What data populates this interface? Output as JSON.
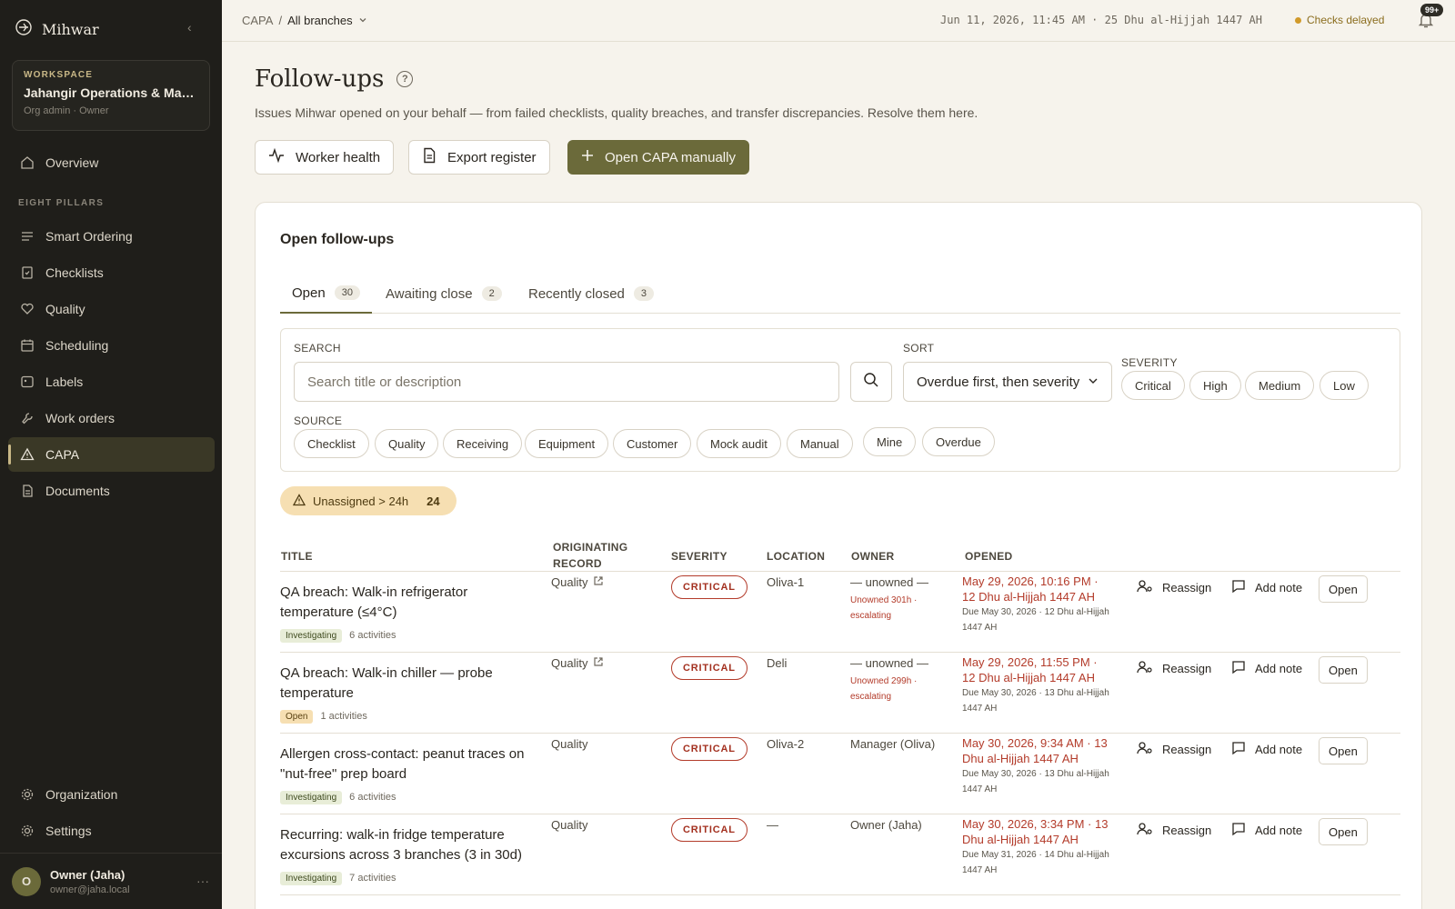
{
  "sidebar": {
    "brand": "Mihwar",
    "workspace_label": "WORKSPACE",
    "workspace_name": "Jahangir Operations & Management",
    "workspace_role": "Org admin · Owner",
    "overview": "Overview",
    "section_label": "EIGHT PILLARS",
    "items": [
      {
        "label": "Smart Ordering",
        "icon": "list-icon"
      },
      {
        "label": "Checklists",
        "icon": "checklist-icon"
      },
      {
        "label": "Quality",
        "icon": "heart-icon"
      },
      {
        "label": "Scheduling",
        "icon": "calendar-icon"
      },
      {
        "label": "Labels",
        "icon": "label-icon"
      },
      {
        "label": "Work orders",
        "icon": "wrench-icon"
      },
      {
        "label": "CAPA",
        "icon": "warning-icon"
      },
      {
        "label": "Documents",
        "icon": "document-icon"
      }
    ],
    "organization": "Organization",
    "settings": "Settings",
    "user_initial": "O",
    "user_name": "Owner (Jaha)",
    "user_email": "owner@jaha.local"
  },
  "topbar": {
    "crumb_root": "CAPA",
    "crumb_sep": "/",
    "branch": "All branches",
    "clock": "Jun 11, 2026, 11:45 AM · 25 Dhu al-Hijjah 1447 AH",
    "status": "Checks delayed",
    "notif_count": "99+"
  },
  "page": {
    "title": "Follow-ups",
    "help": "?",
    "subtitle": "Issues Mihwar opened on your behalf — from failed checklists, quality breaches, and transfer discrepancies. Resolve them here.",
    "btn_worker_health": "Worker health",
    "btn_export": "Export register",
    "btn_open_capa": "Open CAPA manually"
  },
  "card": {
    "title": "Open follow-ups",
    "tabs": [
      {
        "label": "Open",
        "count": "30"
      },
      {
        "label": "Awaiting close",
        "count": "2"
      },
      {
        "label": "Recently closed",
        "count": "3"
      }
    ],
    "search_label": "SEARCH",
    "search_placeholder": "Search title or description",
    "sort_label": "SORT",
    "sort_value": "Overdue first, then severity",
    "severity_label": "SEVERITY",
    "severity_options": [
      "Critical",
      "High",
      "Medium",
      "Low"
    ],
    "source_label": "SOURCE",
    "source_options": [
      "Checklist",
      "Quality",
      "Receiving",
      "Equipment",
      "Customer",
      "Mock audit",
      "Manual"
    ],
    "quick_filters": [
      "Mine",
      "Overdue"
    ],
    "alert_label": "Unassigned > 24h",
    "alert_count": "24"
  },
  "table": {
    "headers": {
      "title": "TITLE",
      "origin": "ORIGINATING RECORD",
      "severity": "SEVERITY",
      "location": "LOCATION",
      "owner": "OWNER",
      "opened": "OPENED"
    },
    "actions": {
      "reassign": "Reassign",
      "note": "Add note",
      "open": "Open"
    },
    "rows": [
      {
        "title": "QA breach: Walk-in refrigerator temperature (≤4°C)",
        "status": "Investigating",
        "activities": "6 activities",
        "origin": "Quality",
        "severity": "CRITICAL",
        "location": "Oliva-1",
        "owner": "— unowned —",
        "owner_sub": "Unowned 301h · escalating",
        "opened": "May 29, 2026, 10:16 PM · 12 Dhu al-Hijjah 1447 AH",
        "due": "Due May 30, 2026 · 12 Dhu al-Hijjah 1447 AH"
      },
      {
        "title": "QA breach: Walk-in chiller — probe temperature",
        "status": "Open",
        "activities": "1 activities",
        "origin": "Quality",
        "severity": "CRITICAL",
        "location": "Deli",
        "owner": "— unowned —",
        "owner_sub": "Unowned 299h · escalating",
        "opened": "May 29, 2026, 11:55 PM · 12 Dhu al-Hijjah 1447 AH",
        "due": "Due May 30, 2026 · 13 Dhu al-Hijjah 1447 AH"
      },
      {
        "title": "Allergen cross-contact: peanut traces on \"nut-free\" prep board",
        "status": "Investigating",
        "activities": "6 activities",
        "origin": "Quality",
        "severity": "CRITICAL",
        "location": "Oliva-2",
        "owner": "Manager (Oliva)",
        "owner_sub": "",
        "opened": "May 30, 2026, 9:34 AM · 13 Dhu al-Hijjah 1447 AH",
        "due": "Due May 30, 2026 · 13 Dhu al-Hijjah 1447 AH"
      },
      {
        "title": "Recurring: walk-in fridge temperature excursions across 3 branches (3 in 30d)",
        "status": "Investigating",
        "activities": "7 activities",
        "origin": "Quality",
        "severity": "CRITICAL",
        "location": "—",
        "owner": "Owner (Jaha)",
        "owner_sub": "",
        "opened": "May 30, 2026, 3:34 PM · 13 Dhu al-Hijjah 1447 AH",
        "due": "Due May 31, 2026 · 14 Dhu al-Hijjah 1447 AH"
      }
    ]
  }
}
